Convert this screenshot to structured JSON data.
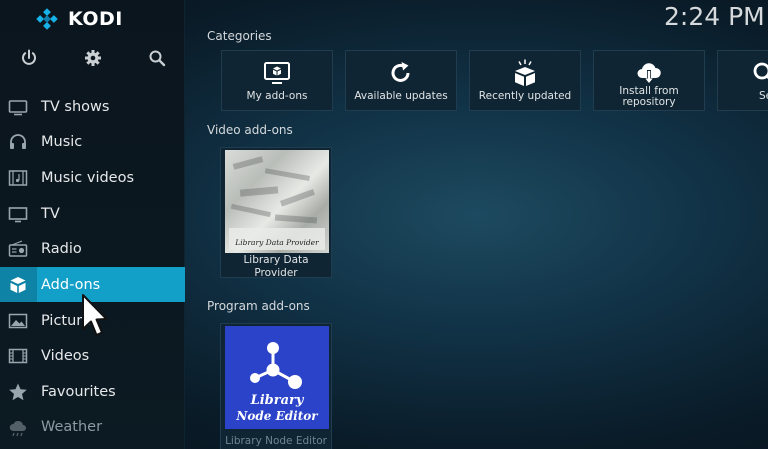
{
  "app": {
    "name": "KODI",
    "brand_color": "#17b2e8"
  },
  "clock": "2:24 PM",
  "top_icons": [
    "power-icon",
    "gear-icon",
    "search-icon"
  ],
  "sidebar": {
    "active_color": "#12a0c8",
    "items": [
      {
        "label": "TV shows",
        "icon": "tv-shows-icon"
      },
      {
        "label": "Music",
        "icon": "headphones-icon"
      },
      {
        "label": "Music videos",
        "icon": "music-videos-icon"
      },
      {
        "label": "TV",
        "icon": "tv-icon"
      },
      {
        "label": "Radio",
        "icon": "radio-icon"
      },
      {
        "label": "Add-ons",
        "icon": "addons-box-icon",
        "active": true
      },
      {
        "label": "Pictures",
        "icon": "pictures-icon"
      },
      {
        "label": "Videos",
        "icon": "videos-icon"
      },
      {
        "label": "Favourites",
        "icon": "star-icon"
      },
      {
        "label": "Weather",
        "icon": "weather-icon"
      }
    ]
  },
  "categories": {
    "title": "Categories",
    "tiles": [
      {
        "label": "My add-ons",
        "icon": "monitor-box-icon"
      },
      {
        "label": "Available updates",
        "icon": "refresh-icon"
      },
      {
        "label": "Recently updated",
        "icon": "box-sparkle-icon"
      },
      {
        "label": "Install from repository",
        "icon": "cloud-download-icon"
      },
      {
        "label": "Se",
        "icon": "search-icon"
      }
    ]
  },
  "video_addons": {
    "title": "Video add-ons",
    "items": [
      {
        "label": "Library Data Provider",
        "thumb_text": "Library Data Provider"
      }
    ]
  },
  "program_addons": {
    "title": "Program add-ons",
    "items": [
      {
        "label": "Library Node Editor",
        "thumb_text_1": "Library",
        "thumb_text_2": "Node Editor",
        "thumb_color": "#2a43c8"
      }
    ]
  }
}
